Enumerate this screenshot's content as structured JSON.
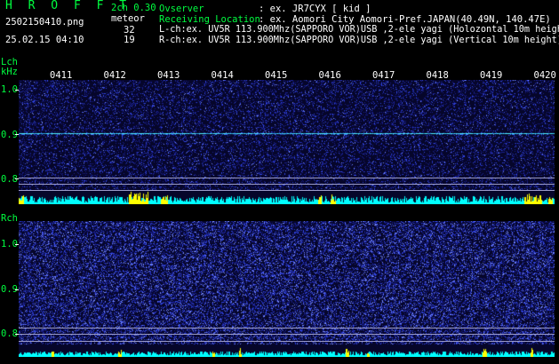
{
  "header": {
    "brand": "H R O F F T",
    "mode": "2ch 0.30",
    "meteor_label": "meteor",
    "filename": "2502150410.png",
    "datetime": "25.02.15 04:10",
    "count_l": "32",
    "count_r": "19",
    "observer_label": "Ovserver",
    "observer_value": ": ex. JR7CYX [ kid ]",
    "location_label": "Receiving Location",
    "location_value": ": ex. Aomori City Aomori-Pref.JAPAN(40.49N, 140.47E)",
    "lch_info": "L-ch:ex. UV5R 113.900Mhz(SAPPORO VOR)USB ,2-ele yagi (Holozontal 10m height)",
    "rch_info": "R-ch:ex. UV5R 113.900Mhz(SAPPORO VOR)USB ,2-ele yagi (Vertical 10m height)"
  },
  "lch": {
    "label": "Lch",
    "unit": "kHz",
    "yticks": [
      "1.0",
      "0.9",
      "0.8"
    ]
  },
  "rch": {
    "label": "Rch",
    "yticks": [
      "1.0",
      "0.9",
      "0.8"
    ]
  },
  "time_labels": [
    "0411",
    "0412",
    "0413",
    "0414",
    "0415",
    "0416",
    "0417",
    "0418",
    "0419",
    "0420"
  ],
  "colors": {
    "label_green": "#00ff40",
    "background": "#000000",
    "noise_dark": "#0a0a3c",
    "noise_bright": "#3c50ff",
    "carrier": "#4ff0ff",
    "level_cyan": "#00ffff",
    "meteor_yellow": "#ffff00"
  }
}
